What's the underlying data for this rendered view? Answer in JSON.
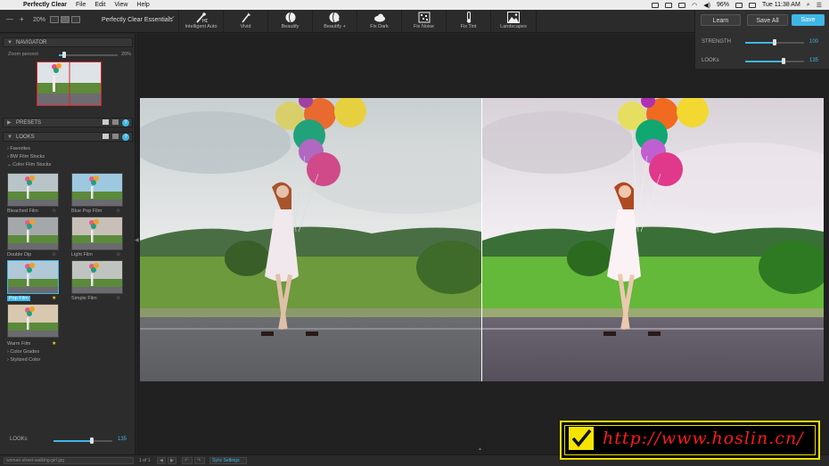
{
  "menubar": {
    "app_name": "Perfectly Clear",
    "items": [
      "File",
      "Edit",
      "View",
      "Help"
    ],
    "battery": "96%",
    "clock": "Tue 11:38 AM"
  },
  "toolbar": {
    "zoom_minus": "—",
    "zoom_plus": "+",
    "zoom_value": "20%",
    "preset_name": "Perfectly Clear Essentials",
    "tools": [
      {
        "label": "Intelligent Auto",
        "icon": "wand-hd-icon"
      },
      {
        "label": "Vivid",
        "icon": "brush-icon"
      },
      {
        "label": "Beautify",
        "icon": "face-icon"
      },
      {
        "label": "Beautify +",
        "icon": "face-plus-icon"
      },
      {
        "label": "Fix Dark",
        "icon": "cloud-icon"
      },
      {
        "label": "Fix Noise",
        "icon": "noise-icon"
      },
      {
        "label": "Fix Tint",
        "icon": "thermometer-icon"
      },
      {
        "label": "Landscapes",
        "icon": "landscape-icon"
      }
    ]
  },
  "right_panel": {
    "learn": "Learn",
    "save_all": "Save All",
    "save": "Save",
    "strength_label": "STRENGTH",
    "strength_value": "100",
    "strength_fraction": 0.5,
    "looks_label": "LOOKs",
    "looks_value": "135",
    "looks_fraction": 0.65,
    "accent": "#3fb7e6"
  },
  "navigator": {
    "title": "NAVIGATOR",
    "zoom_label": "Zoom percent",
    "zoom_value": "20%"
  },
  "presets": {
    "title": "PRESETS"
  },
  "looks": {
    "title": "LOOKS",
    "tree": [
      "Favorites",
      "BW Film Stocks",
      "Color Film Stocks"
    ],
    "thumbs": [
      {
        "label": "Bleached Film",
        "starred": false,
        "selected": false
      },
      {
        "label": "Blue Pop Film",
        "starred": false,
        "selected": false
      },
      {
        "label": "Double Dip",
        "starred": false,
        "selected": false
      },
      {
        "label": "Light Film",
        "starred": false,
        "selected": false
      },
      {
        "label": "Pop Film",
        "starred": true,
        "selected": true
      },
      {
        "label": "Simple Film",
        "starred": false,
        "selected": false
      },
      {
        "label": "Warm Film",
        "starred": true,
        "selected": false
      }
    ],
    "tree_after": [
      "Color Grades",
      "Stylized Color"
    ]
  },
  "bottom_slider": {
    "label": "LOOKs",
    "value": "135",
    "fraction": 0.65
  },
  "bottombar": {
    "filename": "woman-street-walking-girl.jpg",
    "page": "1 of 1",
    "sync": "Sync Settings"
  },
  "watermark": {
    "text": "http://www.hoslin.cn/"
  }
}
